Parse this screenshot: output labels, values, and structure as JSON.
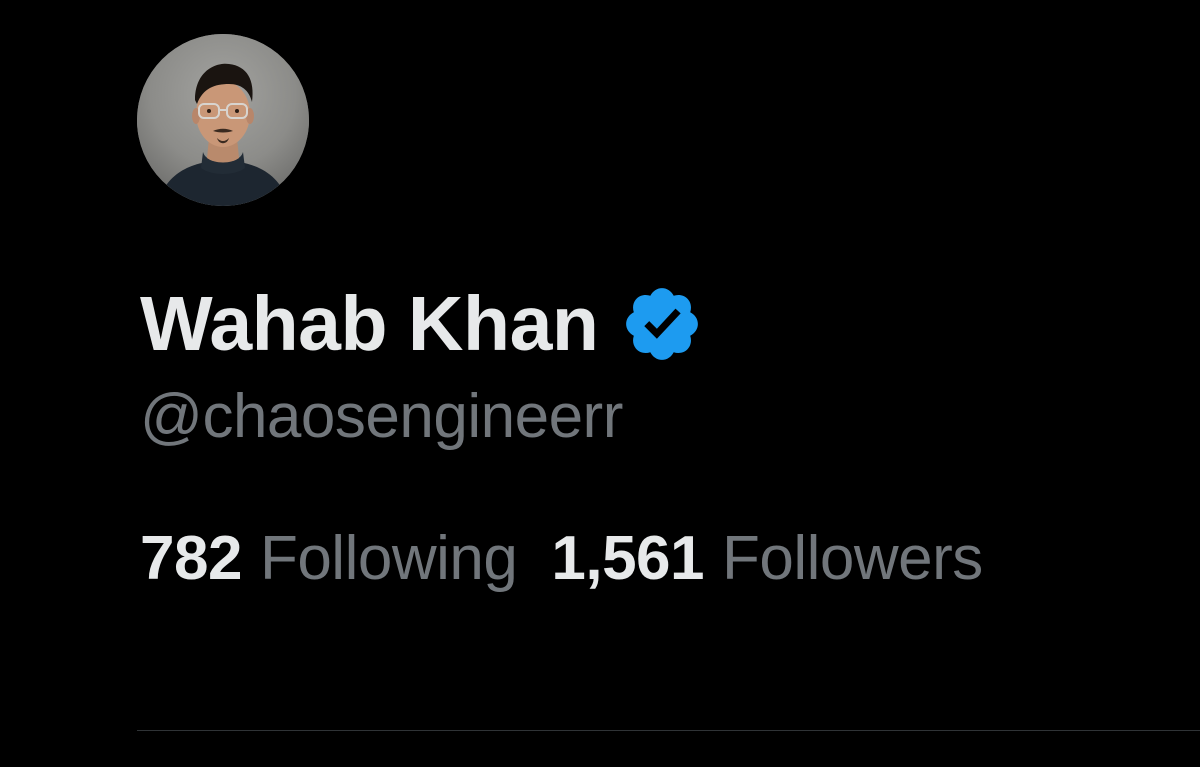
{
  "profile": {
    "display_name": "Wahab Khan",
    "handle": "@chaosengineerr",
    "verified": true,
    "avatar_icon": "avatar-photo",
    "verified_icon": "verified-badge-icon"
  },
  "stats": {
    "following_count": "782",
    "following_label": "Following",
    "followers_count": "1,561",
    "followers_label": "Followers"
  },
  "colors": {
    "background": "#000000",
    "primary_text": "#e7e9ea",
    "secondary_text": "#71767b",
    "verified_blue": "#1d9bf0",
    "divider": "#2f3336"
  }
}
